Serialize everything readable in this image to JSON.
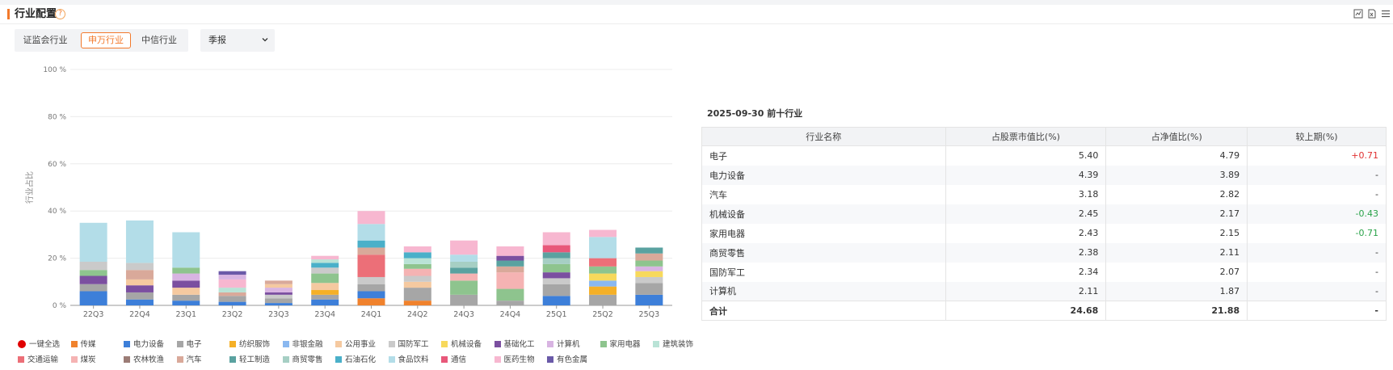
{
  "header": {
    "title": "行业配置",
    "help_glyph": "?",
    "accent_color": "#f2792b"
  },
  "tabs": [
    {
      "label": "证监会行业",
      "active": false
    },
    {
      "label": "申万行业",
      "active": true
    },
    {
      "label": "中信行业",
      "active": false
    }
  ],
  "period_select": {
    "value": "季报"
  },
  "legend": {
    "select_all": "一键全选",
    "items": [
      {
        "name": "传媒",
        "color": "#f0822d"
      },
      {
        "name": "电力设备",
        "color": "#3d7fd9"
      },
      {
        "name": "电子",
        "color": "#a6a6a6"
      },
      {
        "name": "纺织服饰",
        "color": "#f5b027"
      },
      {
        "name": "非银金融",
        "color": "#8ab8f0"
      },
      {
        "name": "公用事业",
        "color": "#f5c9a0"
      },
      {
        "name": "国防军工",
        "color": "#cacaca"
      },
      {
        "name": "机械设备",
        "color": "#f7d95c"
      },
      {
        "name": "基础化工",
        "color": "#7b4fa0"
      },
      {
        "name": "计算机",
        "color": "#d8b4e2"
      },
      {
        "name": "家用电器",
        "color": "#8ec48e"
      },
      {
        "name": "建筑装饰",
        "color": "#b9e3d6"
      },
      {
        "name": "交通运输",
        "color": "#ec6f78"
      },
      {
        "name": "煤炭",
        "color": "#f5b3b3"
      },
      {
        "name": "农林牧渔",
        "color": "#9b7c76"
      },
      {
        "name": "汽车",
        "color": "#d9a99a"
      },
      {
        "name": "轻工制造",
        "color": "#5aa2a0"
      },
      {
        "name": "商贸零售",
        "color": "#a6cfc4"
      },
      {
        "name": "石油石化",
        "color": "#4ab0c9"
      },
      {
        "name": "食品饮料",
        "color": "#b3dde8"
      },
      {
        "name": "通信",
        "color": "#e8587a"
      },
      {
        "name": "医药生物",
        "color": "#f7b7d0"
      },
      {
        "name": "有色金属",
        "color": "#6a5aa8"
      }
    ]
  },
  "chart_data": {
    "type": "bar",
    "stacked": true,
    "ylabel": "行业占比",
    "ylim": [
      0,
      100
    ],
    "yticks": [
      "0 %",
      "20 %",
      "40 %",
      "60 %",
      "80 %",
      "100 %"
    ],
    "categories": [
      "22Q3",
      "22Q4",
      "23Q1",
      "23Q2",
      "23Q3",
      "23Q4",
      "24Q1",
      "24Q2",
      "24Q3",
      "24Q4",
      "25Q1",
      "25Q2",
      "25Q3"
    ],
    "stacks": [
      [
        {
          "s": "电力设备",
          "v": 6.0
        },
        {
          "s": "电子",
          "v": 3.0
        },
        {
          "s": "基础化工",
          "v": 3.5
        },
        {
          "s": "家用电器",
          "v": 2.5
        },
        {
          "s": "国防军工",
          "v": 3.5
        },
        {
          "s": "食品饮料",
          "v": 16.5
        }
      ],
      [
        {
          "s": "电力设备",
          "v": 2.5
        },
        {
          "s": "电子",
          "v": 3.0
        },
        {
          "s": "基础化工",
          "v": 3.0
        },
        {
          "s": "公用事业",
          "v": 2.5
        },
        {
          "s": "汽车",
          "v": 4.0
        },
        {
          "s": "国防军工",
          "v": 3.0
        },
        {
          "s": "食品饮料",
          "v": 18.0
        }
      ],
      [
        {
          "s": "电力设备",
          "v": 2.0
        },
        {
          "s": "电子",
          "v": 2.5
        },
        {
          "s": "公用事业",
          "v": 3.0
        },
        {
          "s": "基础化工",
          "v": 3.0
        },
        {
          "s": "计算机",
          "v": 3.0
        },
        {
          "s": "家用电器",
          "v": 2.5
        },
        {
          "s": "食品饮料",
          "v": 15.0
        }
      ],
      [
        {
          "s": "电力设备",
          "v": 1.5
        },
        {
          "s": "电子",
          "v": 2.5
        },
        {
          "s": "汽车",
          "v": 1.5
        },
        {
          "s": "建筑装饰",
          "v": 2.0
        },
        {
          "s": "医药生物",
          "v": 3.5
        },
        {
          "s": "计算机",
          "v": 2.0
        },
        {
          "s": "有色金属",
          "v": 1.5
        }
      ],
      [
        {
          "s": "电力设备",
          "v": 1.0
        },
        {
          "s": "电子",
          "v": 2.0
        },
        {
          "s": "国防军工",
          "v": 1.5
        },
        {
          "s": "基础化工",
          "v": 1.0
        },
        {
          "s": "计算机",
          "v": 2.0
        },
        {
          "s": "公用事业",
          "v": 1.5
        },
        {
          "s": "汽车",
          "v": 1.5
        }
      ],
      [
        {
          "s": "电力设备",
          "v": 2.5
        },
        {
          "s": "电子",
          "v": 2.0
        },
        {
          "s": "纺织服饰",
          "v": 2.0
        },
        {
          "s": "公用事业",
          "v": 3.0
        },
        {
          "s": "家用电器",
          "v": 4.0
        },
        {
          "s": "国防军工",
          "v": 2.5
        },
        {
          "s": "石油石化",
          "v": 2.0
        },
        {
          "s": "建筑装饰",
          "v": 1.5
        },
        {
          "s": "医药生物",
          "v": 1.5
        }
      ],
      [
        {
          "s": "传媒",
          "v": 3.0
        },
        {
          "s": "电力设备",
          "v": 3.0
        },
        {
          "s": "电子",
          "v": 3.0
        },
        {
          "s": "国防军工",
          "v": 3.0
        },
        {
          "s": "交通运输",
          "v": 9.5
        },
        {
          "s": "汽车",
          "v": 3.0
        },
        {
          "s": "石油石化",
          "v": 3.0
        },
        {
          "s": "食品饮料",
          "v": 7.0
        },
        {
          "s": "医药生物",
          "v": 5.5
        }
      ],
      [
        {
          "s": "传媒",
          "v": 2.0
        },
        {
          "s": "电子",
          "v": 5.5
        },
        {
          "s": "公用事业",
          "v": 2.5
        },
        {
          "s": "国防军工",
          "v": 2.5
        },
        {
          "s": "煤炭",
          "v": 3.0
        },
        {
          "s": "家用电器",
          "v": 2.0
        },
        {
          "s": "建筑装饰",
          "v": 2.5
        },
        {
          "s": "石油石化",
          "v": 2.5
        },
        {
          "s": "医药生物",
          "v": 2.5
        }
      ],
      [
        {
          "s": "电子",
          "v": 4.5
        },
        {
          "s": "家用电器",
          "v": 6.0
        },
        {
          "s": "煤炭",
          "v": 3.0
        },
        {
          "s": "轻工制造",
          "v": 2.5
        },
        {
          "s": "商贸零售",
          "v": 2.5
        },
        {
          "s": "食品饮料",
          "v": 3.0
        },
        {
          "s": "医药生物",
          "v": 6.0
        }
      ],
      [
        {
          "s": "电子",
          "v": 2.0
        },
        {
          "s": "家用电器",
          "v": 5.0
        },
        {
          "s": "煤炭",
          "v": 7.0
        },
        {
          "s": "汽车",
          "v": 2.5
        },
        {
          "s": "轻工制造",
          "v": 2.5
        },
        {
          "s": "基础化工",
          "v": 2.0
        },
        {
          "s": "医药生物",
          "v": 4.0
        }
      ],
      [
        {
          "s": "电力设备",
          "v": 4.0
        },
        {
          "s": "电子",
          "v": 5.0
        },
        {
          "s": "国防军工",
          "v": 2.5
        },
        {
          "s": "基础化工",
          "v": 2.5
        },
        {
          "s": "家用电器",
          "v": 3.5
        },
        {
          "s": "商贸零售",
          "v": 2.5
        },
        {
          "s": "轻工制造",
          "v": 2.5
        },
        {
          "s": "通信",
          "v": 3.0
        },
        {
          "s": "医药生物",
          "v": 5.5
        }
      ],
      [
        {
          "s": "电子",
          "v": 4.5
        },
        {
          "s": "纺织服饰",
          "v": 3.5
        },
        {
          "s": "非银金融",
          "v": 2.5
        },
        {
          "s": "机械设备",
          "v": 3.0
        },
        {
          "s": "家用电器",
          "v": 3.0
        },
        {
          "s": "交通运输",
          "v": 3.5
        },
        {
          "s": "食品饮料",
          "v": 9.0
        },
        {
          "s": "医药生物",
          "v": 3.0
        }
      ],
      [
        {
          "s": "电力设备",
          "v": 4.5
        },
        {
          "s": "电子",
          "v": 5.0
        },
        {
          "s": "国防军工",
          "v": 2.5
        },
        {
          "s": "机械设备",
          "v": 2.5
        },
        {
          "s": "计算机",
          "v": 2.0
        },
        {
          "s": "家用电器",
          "v": 2.5
        },
        {
          "s": "汽车",
          "v": 3.0
        },
        {
          "s": "轻工制造",
          "v": 2.5
        }
      ]
    ]
  },
  "top_table": {
    "title": "2025-09-30 前十行业",
    "columns": [
      "行业名称",
      "占股票市值比(%)",
      "占净值比(%)",
      "较上期(%)"
    ],
    "rows": [
      {
        "name": "电子",
        "stock_pct": "5.40",
        "nav_pct": "4.79",
        "change": "+0.71",
        "change_color": "#e03030"
      },
      {
        "name": "电力设备",
        "stock_pct": "4.39",
        "nav_pct": "3.89",
        "change": "-",
        "change_color": "#333333"
      },
      {
        "name": "汽车",
        "stock_pct": "3.18",
        "nav_pct": "2.82",
        "change": "-",
        "change_color": "#333333"
      },
      {
        "name": "机械设备",
        "stock_pct": "2.45",
        "nav_pct": "2.17",
        "change": "-0.43",
        "change_color": "#2aa34a"
      },
      {
        "name": "家用电器",
        "stock_pct": "2.43",
        "nav_pct": "2.15",
        "change": "-0.71",
        "change_color": "#2aa34a"
      },
      {
        "name": "商贸零售",
        "stock_pct": "2.38",
        "nav_pct": "2.11",
        "change": "-",
        "change_color": "#333333"
      },
      {
        "name": "国防军工",
        "stock_pct": "2.34",
        "nav_pct": "2.07",
        "change": "-",
        "change_color": "#333333"
      },
      {
        "name": "计算机",
        "stock_pct": "2.11",
        "nav_pct": "1.87",
        "change": "-",
        "change_color": "#333333"
      }
    ],
    "total": {
      "name": "合计",
      "stock_pct": "24.68",
      "nav_pct": "21.88",
      "change": "-"
    }
  }
}
